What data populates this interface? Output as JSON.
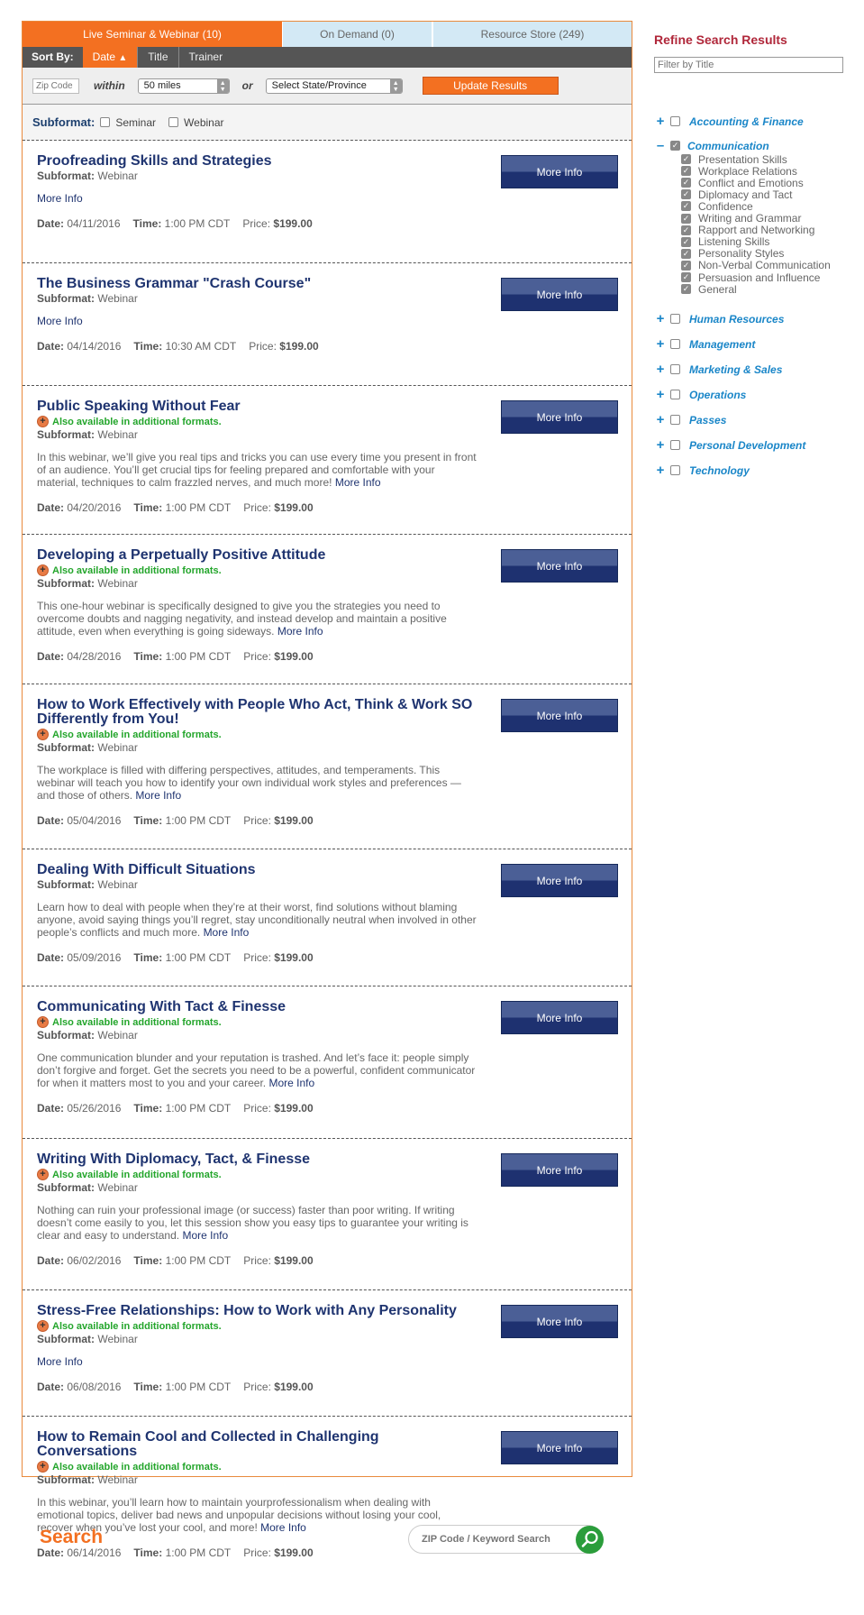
{
  "tabs": [
    {
      "label": "Live Seminar & Webinar (10)",
      "active": true
    },
    {
      "label": "On Demand (0)",
      "active": false
    },
    {
      "label": "Resource Store (249)",
      "active": false
    }
  ],
  "sortbar": {
    "label": "Sort By:",
    "options": [
      {
        "label": "Date",
        "active": true,
        "icon": "sort-up-arrow"
      },
      {
        "label": "Title",
        "active": false
      },
      {
        "label": "Trainer",
        "active": false
      }
    ]
  },
  "filters": {
    "zip_placeholder": "Zip Code",
    "within_label": "within",
    "miles_value": "50 miles",
    "or_label": "or",
    "state_value": "Select State/Province",
    "update_label": "Update Results"
  },
  "subformat": {
    "label": "Subformat:",
    "options": [
      {
        "label": "Seminar",
        "checked": false
      },
      {
        "label": "Webinar",
        "checked": false
      }
    ]
  },
  "labels": {
    "subformat": "Subformat:",
    "date": "Date:",
    "time": "Time:",
    "price": "Price:",
    "more_info_button": "More Info",
    "more_info_link": "More Info",
    "also_available": "Also available in additional formats."
  },
  "items": [
    {
      "title": "Proofreading Skills and Strategies",
      "also_available": false,
      "subformat": "Webinar",
      "description": "",
      "date": "04/11/2016",
      "time": "1:00 PM CDT",
      "price": "$199.00"
    },
    {
      "title": "The Business Grammar \"Crash Course\"",
      "also_available": false,
      "subformat": "Webinar",
      "description": "",
      "date": "04/14/2016",
      "time": "10:30 AM CDT",
      "price": "$199.00"
    },
    {
      "title": "Public Speaking Without Fear",
      "also_available": true,
      "subformat": "Webinar",
      "description": "In this webinar, we’ll give you real tips and tricks you can use every time you present in front of an audience. You’ll get crucial tips for feeling prepared and comfortable with your material, techniques to calm frazzled nerves, and much more!",
      "date": "04/20/2016",
      "time": "1:00 PM CDT",
      "price": "$199.00"
    },
    {
      "title": "Developing a Perpetually Positive Attitude",
      "also_available": true,
      "subformat": "Webinar",
      "description": "This one-hour webinar is specifically designed to give you the strategies you need to overcome doubts and nagging negativity, and instead develop and maintain a positive attitude, even when everything is going sideways.",
      "date": "04/28/2016",
      "time": "1:00 PM CDT",
      "price": "$199.00"
    },
    {
      "title": "How to Work Effectively with People Who Act, Think & Work SO Differently from You!",
      "also_available": true,
      "subformat": "Webinar",
      "description": "The workplace is filled with differing perspectives, attitudes, and temperaments. This webinar will teach you how to identify your own individual work styles and preferences — and those of others.",
      "date": "05/04/2016",
      "time": "1:00 PM CDT",
      "price": "$199.00"
    },
    {
      "title": "Dealing With Difficult Situations",
      "also_available": false,
      "subformat": "Webinar",
      "description": "Learn how to deal with people when they’re at their worst, find solutions without blaming anyone, avoid saying things you’ll regret, stay unconditionally neutral when involved in other people’s conflicts and much more.",
      "date": "05/09/2016",
      "time": "1:00 PM CDT",
      "price": "$199.00"
    },
    {
      "title": "Communicating With Tact & Finesse",
      "also_available": true,
      "subformat": "Webinar",
      "description": "One communication blunder and your reputation is trashed. And let’s face it: people simply don’t forgive and forget. Get the secrets you need to be a powerful, confident communicator for when it matters most to you and your career.",
      "date": "05/26/2016",
      "time": "1:00 PM CDT",
      "price": "$199.00"
    },
    {
      "title": "Writing With Diplomacy, Tact, & Finesse",
      "also_available": true,
      "subformat": "Webinar",
      "description": "Nothing can ruin your professional image (or success) faster than poor writing. If writing doesn’t come easily to you, let this session show you easy tips to guarantee your writing is clear and easy to understand.",
      "date": "06/02/2016",
      "time": "1:00 PM CDT",
      "price": "$199.00"
    },
    {
      "title": "Stress-Free Relationships: How to Work with Any Personality",
      "also_available": true,
      "subformat": "Webinar",
      "description": "",
      "date": "06/08/2016",
      "time": "1:00 PM CDT",
      "price": "$199.00"
    },
    {
      "title": "How to Remain Cool and Collected in Challenging Conversations",
      "also_available": true,
      "subformat": "Webinar",
      "description": "In this webinar, you’ll learn how to maintain yourprofessionalism when dealing with emotional topics, deliver bad news and unpopular decisions without losing your cool, recover when you’ve lost your cool, and more!",
      "date": "06/14/2016",
      "time": "1:00 PM CDT",
      "price": "$199.00"
    }
  ],
  "sidebar": {
    "title": "Refine Search Results",
    "filter_placeholder": "Filter by Title",
    "categories": [
      {
        "label": "Accounting & Finance",
        "expanded": false,
        "checked": false,
        "children": []
      },
      {
        "label": "Communication",
        "expanded": true,
        "checked": true,
        "children": [
          "Presentation Skills",
          "Workplace Relations",
          "Conflict and Emotions",
          "Diplomacy and Tact",
          "Confidence",
          "Writing and Grammar",
          "Rapport and Networking",
          "Listening Skills",
          "Personality Styles",
          "Non-Verbal Communication",
          "Persuasion and Influence",
          "General"
        ]
      },
      {
        "label": "Human Resources",
        "expanded": false,
        "checked": false,
        "children": []
      },
      {
        "label": "Management",
        "expanded": false,
        "checked": false,
        "children": []
      },
      {
        "label": "Marketing & Sales",
        "expanded": false,
        "checked": false,
        "children": []
      },
      {
        "label": "Operations",
        "expanded": false,
        "checked": false,
        "children": []
      },
      {
        "label": "Passes",
        "expanded": false,
        "checked": false,
        "children": []
      },
      {
        "label": "Personal Development",
        "expanded": false,
        "checked": false,
        "children": []
      },
      {
        "label": "Technology",
        "expanded": false,
        "checked": false,
        "children": []
      }
    ]
  },
  "bottom_search": {
    "title": "Search",
    "placeholder": "ZIP Code / Keyword Search",
    "icon": "search-icon"
  },
  "colors": {
    "accent_orange": "#f37021",
    "navy": "#1f3470",
    "green": "#23a52b",
    "sidebar_title": "#b0273a",
    "sidebar_link": "#1a86c8"
  }
}
